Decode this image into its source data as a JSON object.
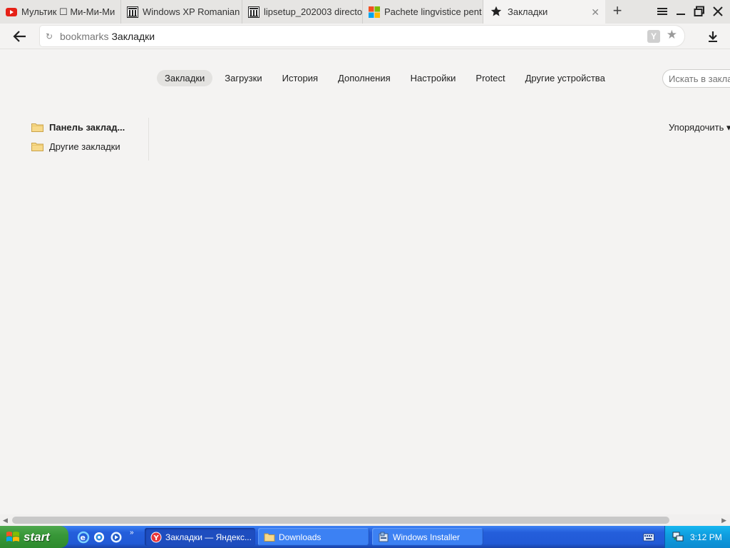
{
  "tabs": [
    {
      "title": "Мультик ☐ Ми-Ми-Ми",
      "icon": "youtube-icon"
    },
    {
      "title": "Windows XP Romanian",
      "icon": "archive-icon"
    },
    {
      "title": "lipsetup_202003 directo",
      "icon": "archive-icon"
    },
    {
      "title": "Pachete lingvistice pent",
      "icon": "microsoft-icon"
    },
    {
      "title": "Закладки",
      "icon": "star-icon"
    }
  ],
  "address": {
    "host": "bookmarks",
    "title": "Закладки"
  },
  "nav": {
    "items": [
      "Закладки",
      "Загрузки",
      "История",
      "Дополнения",
      "Настройки",
      "Protect",
      "Другие устройства"
    ]
  },
  "search": {
    "placeholder": "Искать в закладках"
  },
  "sidebar": {
    "folders": [
      "Панель заклад...",
      "Другие закладки"
    ]
  },
  "sort_label": "Упорядочить ▾",
  "taskbar": {
    "start_label": "start",
    "quicklaunch_chevron": "»",
    "tasks": [
      "Закладки — Яндекс...",
      "Downloads",
      "Windows Installer"
    ],
    "clock": "3:12 PM"
  }
}
